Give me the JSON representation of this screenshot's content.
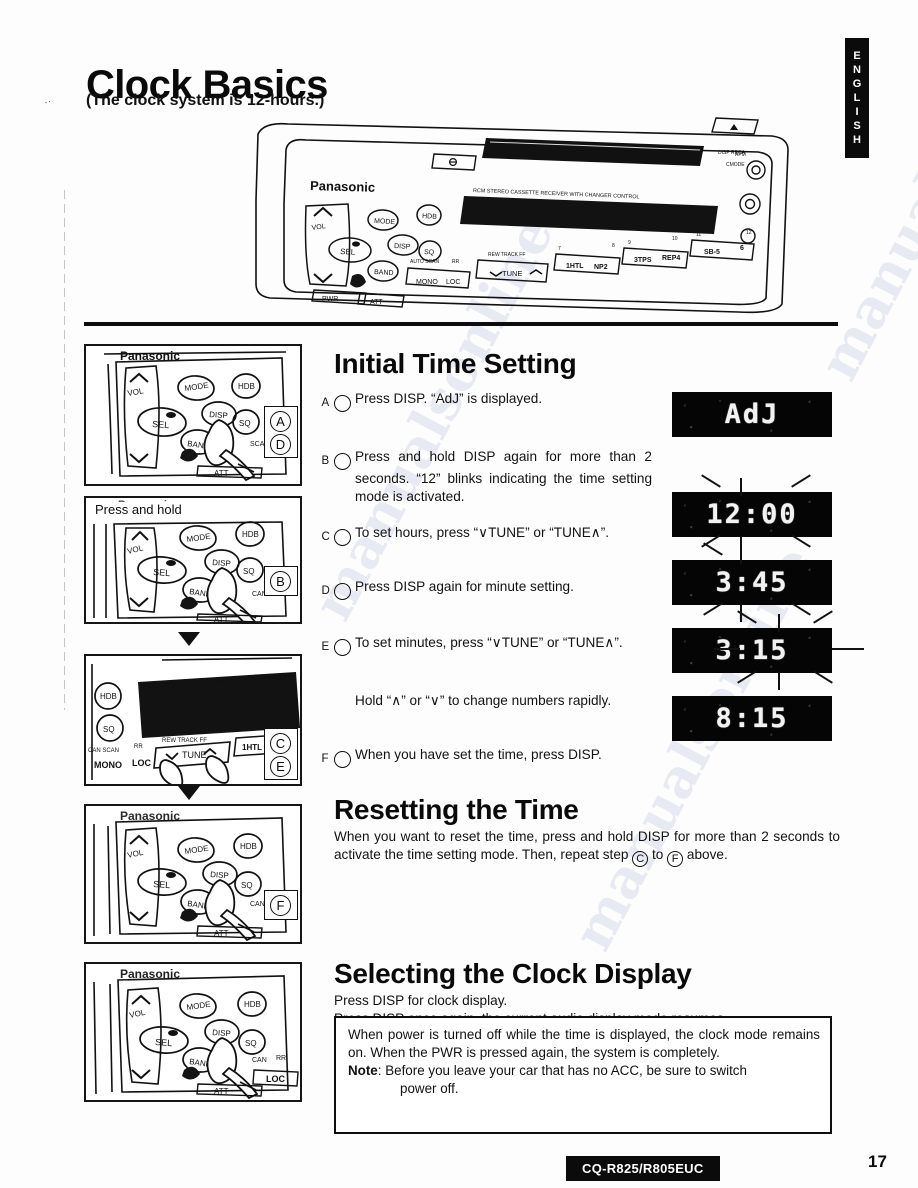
{
  "language_tab": "ENGLISH",
  "header": {
    "title": "Clock Basics",
    "subtitle": "(The clock system is 12-hours.)"
  },
  "unit": {
    "brand": "Panasonic",
    "buttons": [
      "VOL",
      "SEL",
      "MODE",
      "DISP",
      "BAND",
      "HDB",
      "PWR",
      "ATT",
      "MONO",
      "LOC",
      "TUNE",
      "SQ"
    ],
    "preset_buttons": [
      "1HTL",
      "NP2",
      "3TPS",
      "REP4",
      "SB-5",
      "6"
    ],
    "sub_labels": [
      "AUTO SCAN",
      "RR",
      "REW",
      "TRACK",
      "FF",
      "RCM",
      "STEREO CASSETTE RECEIVER WITH CHANGER CONTROL",
      "DISP RECA",
      "EJECT"
    ]
  },
  "illustrations": [
    {
      "name": "panel-disp-press",
      "badges": [
        "A",
        "D"
      ],
      "caption": ""
    },
    {
      "name": "panel-press-and-hold",
      "badges": [
        "B"
      ],
      "caption": "Press and hold"
    },
    {
      "name": "panel-tune-buttons",
      "badges": [
        "C",
        "E"
      ],
      "caption": ""
    },
    {
      "name": "panel-disp-final",
      "badges": [
        "F"
      ],
      "caption": ""
    },
    {
      "name": "panel-disp-clock-display",
      "badges": [],
      "caption": ""
    }
  ],
  "sections": {
    "initial_time_setting": {
      "heading": "Initial Time Setting",
      "steps": [
        {
          "letter": "A",
          "text": "Press DISP. “AdJ” is displayed."
        },
        {
          "letter": "B",
          "text": "Press and hold DISP again for more than 2 seconds. “12” blinks indicating the time setting mode is activated."
        },
        {
          "letter": "C",
          "text": "To set hours, press “∨TUNE” or “TUNE∧”."
        },
        {
          "letter": "D",
          "text": "Press DISP again for minute setting."
        },
        {
          "letter": "E",
          "text": "To set minutes, press “∨TUNE” or “TUNE∧”.",
          "note": "Hold “∧” or “∨” to change numbers rapidly."
        },
        {
          "letter": "F",
          "text": "When you have set the time, press DISP."
        }
      ]
    },
    "resetting_the_time": {
      "heading": "Resetting the Time",
      "body_part1": "When you want to reset the time, press and hold DISP for more than 2 seconds to activate the time setting mode. Then, repeat step",
      "body_letter1": "C",
      "body_mid": "to",
      "body_letter2": "F",
      "body_part2": "above."
    },
    "selecting_the_clock_display": {
      "heading": "Selecting the Clock Display",
      "line1": "Press DISP for clock display.",
      "line2": "Press DISP once again, the current audio display mode resumes."
    }
  },
  "note_box": {
    "body": "When power is turned off while the time is displayed, the clock mode remains on. When the PWR is pressed again, the system is completely.",
    "note_label": "Note",
    "note_text": ": Before you leave your car that has no ACC, be sure to switch",
    "note_text_cont": "power off."
  },
  "lcd_displays": [
    {
      "name": "lcd-adj",
      "value": "AdJ",
      "step": "A"
    },
    {
      "name": "lcd-1200",
      "value": "12:00",
      "step": "B"
    },
    {
      "name": "lcd-345",
      "value": "3:45",
      "step": "C"
    },
    {
      "name": "lcd-315",
      "value": "3:15",
      "step": "D"
    },
    {
      "name": "lcd-815",
      "value": "8:15",
      "step": "E"
    }
  ],
  "footer": {
    "model": "CQ-R825/R805EUC",
    "page_number": "17"
  },
  "watermark": "manualsonline"
}
